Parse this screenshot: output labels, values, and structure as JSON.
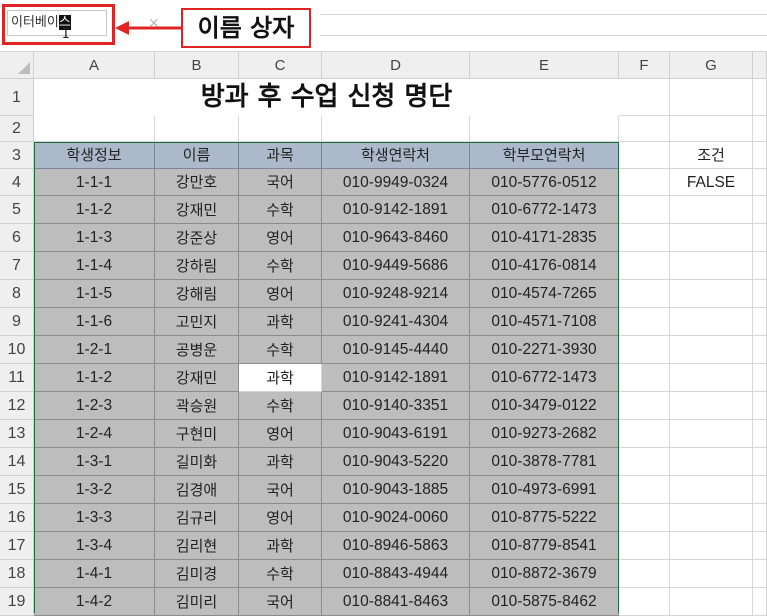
{
  "name_box": {
    "text_before": "이터베이",
    "text_selected": "스"
  },
  "callout": {
    "label": "이름 상자"
  },
  "formula_bar": {
    "cancel_glyph": "✕"
  },
  "columns": [
    "A",
    "B",
    "C",
    "D",
    "E",
    "F",
    "G"
  ],
  "row_numbers": [
    "1",
    "2",
    "3",
    "4",
    "5",
    "6",
    "7",
    "8",
    "9",
    "10",
    "11",
    "12",
    "13",
    "14",
    "15",
    "16",
    "17",
    "18",
    "19"
  ],
  "sheet_title": "방과 후 수업 신청 명단",
  "headers": [
    "학생정보",
    "이름",
    "과목",
    "학생연락처",
    "학부모연락처"
  ],
  "condition": {
    "label": "조건",
    "value": "FALSE"
  },
  "rows": [
    [
      "1-1-1",
      "강만호",
      "국어",
      "010-9949-0324",
      "010-5776-0512"
    ],
    [
      "1-1-2",
      "강재민",
      "수학",
      "010-9142-1891",
      "010-6772-1473"
    ],
    [
      "1-1-3",
      "강준상",
      "영어",
      "010-9643-8460",
      "010-4171-2835"
    ],
    [
      "1-1-4",
      "강하림",
      "수학",
      "010-9449-5686",
      "010-4176-0814"
    ],
    [
      "1-1-5",
      "강해림",
      "영어",
      "010-9248-9214",
      "010-4574-7265"
    ],
    [
      "1-1-6",
      "고민지",
      "과학",
      "010-9241-4304",
      "010-4571-7108"
    ],
    [
      "1-2-1",
      "공병운",
      "수학",
      "010-9145-4440",
      "010-2271-3930"
    ],
    [
      "1-1-2",
      "강재민",
      "과학",
      "010-9142-1891",
      "010-6772-1473"
    ],
    [
      "1-2-3",
      "곽승원",
      "수학",
      "010-9140-3351",
      "010-3479-0122"
    ],
    [
      "1-2-4",
      "구현미",
      "영어",
      "010-9043-6191",
      "010-9273-2682"
    ],
    [
      "1-3-1",
      "길미화",
      "과학",
      "010-9043-5220",
      "010-3878-7781"
    ],
    [
      "1-3-2",
      "김경애",
      "국어",
      "010-9043-1885",
      "010-4973-6991"
    ],
    [
      "1-3-3",
      "김규리",
      "영어",
      "010-9024-0060",
      "010-8775-5222"
    ],
    [
      "1-3-4",
      "김리현",
      "과학",
      "010-8946-5863",
      "010-8779-8541"
    ],
    [
      "1-4-1",
      "김미경",
      "수학",
      "010-8843-4944",
      "010-8872-3679"
    ],
    [
      "1-4-2",
      "김미리",
      "국어",
      "010-8841-8463",
      "010-5875-8462"
    ]
  ],
  "colors": {
    "header_fill": "#acb9ca",
    "data_fill": "#bdbdbd",
    "highlight": "#e02424",
    "table_border": "#1e6b3c"
  }
}
